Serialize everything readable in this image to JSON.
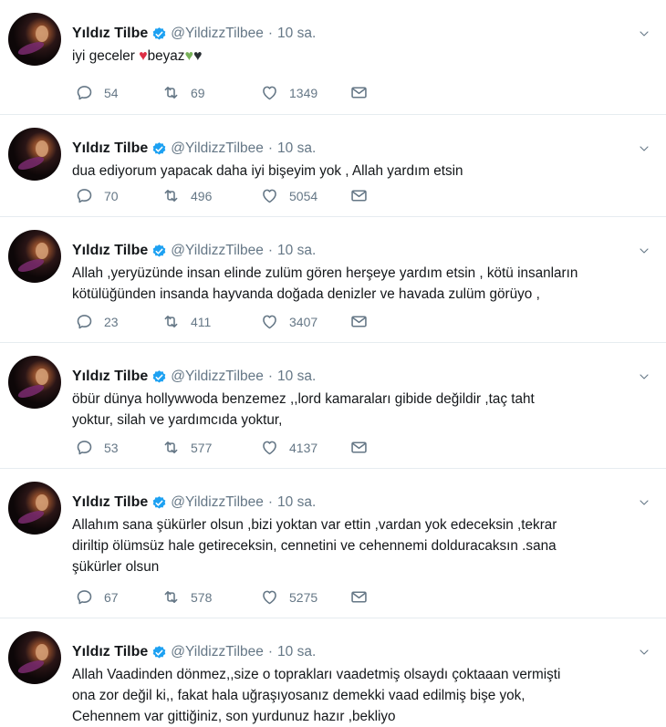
{
  "tweets": [
    {
      "name": "Yıldız Tilbe",
      "handle": "@YildizzTilbee",
      "time": "10 sa.",
      "lines": [
        "iyi geceler",
        "beyaz"
      ],
      "emoji_line": true,
      "hearts": [
        {
          "color": "#dd2e44",
          "name": "red-heart-icon"
        },
        {
          "color": "#78b159",
          "name": "green-heart-icon"
        },
        {
          "color": "#292f33",
          "name": "black-heart-icon"
        }
      ],
      "replies": "54",
      "retweets": "69",
      "likes": "1349"
    },
    {
      "name": "Yıldız Tilbe",
      "handle": "@YildizzTilbee",
      "time": "10 sa.",
      "lines": [
        "dua ediyorum yapacak daha iyi bişeyim yok , Allah yardım etsin"
      ],
      "replies": "70",
      "retweets": "496",
      "likes": "5054"
    },
    {
      "name": "Yıldız Tilbe",
      "handle": "@YildizzTilbee",
      "time": "10 sa.",
      "lines": [
        "Allah ,yeryüzünde insan elinde zulüm gören herşeye yardım etsin , kötü insanların",
        "kötülüğünden insanda hayvanda doğada denizler ve havada zulüm görüyo ,"
      ],
      "replies": "23",
      "retweets": "411",
      "likes": "3407"
    },
    {
      "name": "Yıldız Tilbe",
      "handle": "@YildizzTilbee",
      "time": "10 sa.",
      "lines": [
        "öbür dünya hollywwoda benzemez ,,lord kamaraları gibide değildir ,taç taht",
        "yoktur, silah ve yardımcıda yoktur,"
      ],
      "replies": "53",
      "retweets": "577",
      "likes": "4137"
    },
    {
      "name": "Yıldız Tilbe",
      "handle": "@YildizzTilbee",
      "time": "10 sa.",
      "lines": [
        "Allahım sana şükürler olsun ,bizi yoktan var ettin ,vardan yok edeceksin ,tekrar",
        "diriltip ölümsüz hale getireceksin, cennetini ve cehennemi dolduracaksın .sana",
        "şükürler olsun"
      ],
      "replies": "67",
      "retweets": "578",
      "likes": "5275"
    },
    {
      "name": "Yıldız Tilbe",
      "handle": "@YildizzTilbee",
      "time": "10 sa.",
      "lines": [
        "Allah Vaadinden dönmez,,size o toprakları vaadetmiş olsaydı çoktaaan vermişti",
        "ona zor değil ki,, fakat hala uğraşıyosanız demekki vaad edilmiş bişe yok,",
        "Cehennem var gittiğiniz, son yurdunuz  hazır ,bekliyo"
      ]
    }
  ],
  "colors": {
    "verified": "#1da1f2",
    "muted": "#657786",
    "text": "#14171a",
    "divider": "#e6ecf0"
  }
}
